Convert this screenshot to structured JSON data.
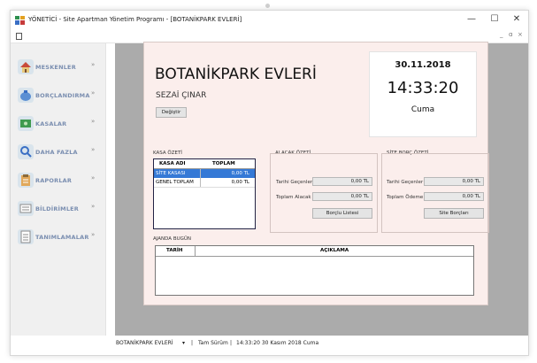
{
  "window": {
    "title": "YÖNETİCİ - Site Apartman Yönetim Programı - [BOTANİKPARK EVLERİ]",
    "minimize": "—",
    "maximize": "☐",
    "close": "✕",
    "mdi_min": "_",
    "mdi_restore": "ɑ",
    "mdi_close": "×"
  },
  "sidebar": {
    "items": [
      {
        "label": "MESKENLER",
        "icon": "house-icon"
      },
      {
        "label": "BORÇLANDIRMA",
        "icon": "money-bag-icon"
      },
      {
        "label": "KASALAR",
        "icon": "cash-box-icon"
      },
      {
        "label": "DAHA FAZLA",
        "icon": "magnifier-icon"
      },
      {
        "label": "RAPORLAR",
        "icon": "clipboard-icon"
      },
      {
        "label": "BİLDİRİMLER",
        "icon": "notification-icon"
      },
      {
        "label": "TANIMLAMALAR",
        "icon": "document-icon"
      }
    ],
    "chevron": "»"
  },
  "header": {
    "site_name": "BOTANİKPARK EVLERİ",
    "person": "SEZAİ ÇINAR",
    "change_button": "Değiştir",
    "date": "30.11.2018",
    "time": "14:33:20",
    "day": "Cuma"
  },
  "kasa": {
    "title": "KASA ÖZETİ",
    "columns": [
      "KASA ADI",
      "TOPLAM"
    ],
    "rows": [
      {
        "name": "SİTE KASASI",
        "total": "0,00 TL"
      },
      {
        "name": "GENEL TOPLAM",
        "total": "0,00 TL"
      }
    ]
  },
  "alacak": {
    "title": "ALACAK ÖZETİ",
    "label1": "Tarihi Geçenler :",
    "value1": "0,00 TL",
    "label2": "Toplam Alacak :",
    "value2": "0,00 TL",
    "button": "Borçlu Listesi"
  },
  "borc": {
    "title": "SİTE BORÇ ÖZETİ",
    "label1": "Tarihi Geçenler :",
    "value1": "0,00 TL",
    "label2": "Toplam Ödeme :",
    "value2": "0,00 TL",
    "button": "Site Borçları"
  },
  "ajanda": {
    "title": "AJANDA BUGÜN",
    "columns": [
      "TARİH",
      "AÇIKLAMA"
    ]
  },
  "status": {
    "site": "BOTANİKPARK EVLERİ",
    "dropdown": "▾",
    "sep": "|",
    "version": "Tam Sürüm",
    "datetime": "14:33:20  30 Kasım 2018 Cuma"
  },
  "colors": {
    "panel_bg": "#fbeeec",
    "selection": "#3579d6",
    "mdi_bg": "#ababab",
    "sidebar_label": "#7a8eb0"
  }
}
